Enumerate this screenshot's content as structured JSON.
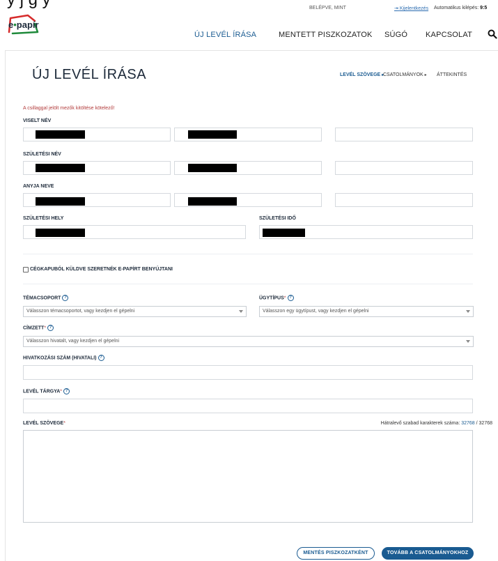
{
  "top_strip": {
    "cut_title": "y                                    j    g y",
    "logged_in_as": "BELÉPVE, MINT",
    "logout": "Kijelentkezés",
    "auto_logout_label": "Automatikus kilépés:",
    "auto_logout_time": "9:5"
  },
  "header": {
    "logo_text_1": "e",
    "logo_dot": "•",
    "logo_text_2": "papír",
    "nav": [
      {
        "label": "ÚJ LEVÉL ÍRÁSA",
        "active": true
      },
      {
        "label": "MENTETT PISZKOZATOK",
        "active": false
      },
      {
        "label": "SÚGÓ",
        "active": false
      },
      {
        "label": "KAPCSOLAT",
        "active": false
      }
    ],
    "search_icon": "search-icon"
  },
  "page": {
    "title": "ÚJ LEVÉL ÍRÁSA",
    "steps": [
      {
        "label": "LEVÉL SZÖVEGE",
        "active": true,
        "arrow": "▸"
      },
      {
        "label": "CSATOLMÁNYOK",
        "active": false,
        "arrow": "▸"
      },
      {
        "label": "ÁTTEKINTÉS",
        "active": false,
        "arrow": ""
      }
    ]
  },
  "form": {
    "required_note": "A csillaggal jelölt mezők kitöltése kötelező!",
    "viselt_nev": "VISELT NÉV",
    "szuletesi_nev": "SZÜLETÉSI NÉV",
    "anyja_neve": "ANYJA NEVE",
    "szuletesi_hely": "SZÜLETÉSI HELY",
    "szuletesi_ido": "SZÜLETÉSI IDŐ",
    "cegkapu": "CÉGKAPUBÓL KÜLDVE SZERETNÉK E-PAPÍRT BENYÚJTANI",
    "temacsoport": {
      "label": "TÉMACSOPORT",
      "placeholder": "Válasszon témacsoportot, vagy kezdjen el gépelni"
    },
    "ugytipus": {
      "label": "ÜGYTÍPUS",
      "star": "*",
      "placeholder": "Válasszon egy ügytípust, vagy kezdjen el gépelni"
    },
    "cimzett": {
      "label": "CÍMZETT",
      "star": "*",
      "placeholder": "Válasszon hivatalt, vagy kezdjen el gépelni"
    },
    "hivatkozasi_szam": "HIVATKOZÁSI SZÁM (HIVATALI)",
    "level_targya": {
      "label": "LEVÉL TÁRGYA",
      "star": "*"
    },
    "level_szovege": {
      "label": "LEVÉL SZÖVEGE",
      "star": "*"
    },
    "counter_label": "Hátralevő szabad karakterek száma:",
    "counter_value": "32768",
    "counter_total": "/ 32768",
    "help_glyph": "?"
  },
  "buttons": {
    "save_draft": "MENTÉS PISZKOZATKÉNT",
    "next": "TOVÁBB A CSATOLMÁNYOKHOZ"
  },
  "colors": {
    "accent": "#1a5b91",
    "required": "#b23b3b",
    "logo_green": "#1f8a3b",
    "logo_red": "#d62b2b"
  }
}
